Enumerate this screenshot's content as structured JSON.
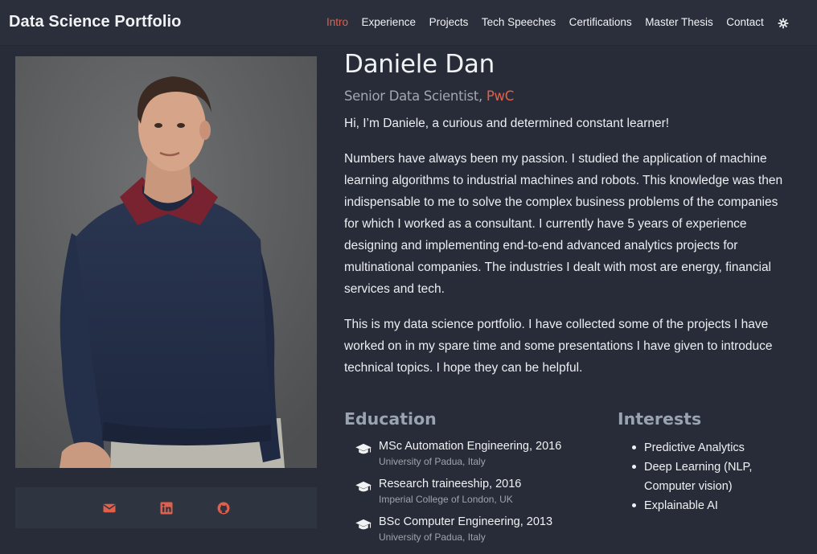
{
  "navbar": {
    "brand": "Data Science Portfolio",
    "links": [
      "Intro",
      "Experience",
      "Projects",
      "Tech Speeches",
      "Certifications",
      "Master Thesis",
      "Contact"
    ],
    "active_link": "Intro",
    "theme_toggle_icon": "gear-icon"
  },
  "profile": {
    "name": "Daniele Dan",
    "role": "Senior Data Scientist,",
    "company": "PwC",
    "social_icons": [
      "email-icon",
      "linkedin-icon",
      "github-icon"
    ]
  },
  "intro": {
    "greeting": "Hi, I’m Daniele, a curious and determined constant learner!",
    "paragraph1": "Numbers have always been my passion. I studied the application of machine learning algorithms to industrial machines and robots. This knowledge was then indispensable to me to solve the complex business problems of the companies for which I worked as a consultant. I currently have 5 years of experience designing and implementing end-to-end advanced analytics projects for multinational companies. The industries I dealt with most are energy, financial services and tech.",
    "paragraph2": "This is my data science portfolio. I have collected some of the projects I have worked on in my spare time and some presentations I have given to introduce technical topics. I hope they can be helpful."
  },
  "education": {
    "title": "Education",
    "items": [
      {
        "degree": "MSc Automation Engineering, 2016",
        "school": "University of Padua, Italy"
      },
      {
        "degree": "Research traineeship, 2016",
        "school": "Imperial College of London, UK"
      },
      {
        "degree": "BSc Computer Engineering, 2013",
        "school": "University of Padua, Italy"
      }
    ]
  },
  "interests": {
    "title": "Interests",
    "items": [
      "Predictive Analytics",
      "Deep Learning (NLP, Computer vision)",
      "Explainable AI"
    ]
  },
  "colors": {
    "background": "#272c38",
    "accent": "#e2604b",
    "heading_muted": "#9aa3b0"
  }
}
